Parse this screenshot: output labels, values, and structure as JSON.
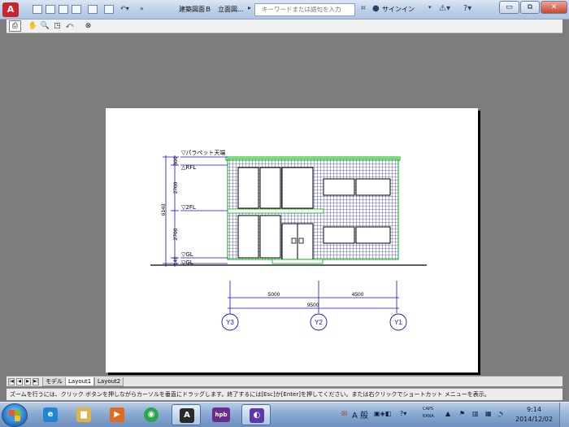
{
  "title_bar": {
    "document_title": "建築図面Ｂ　立面図...",
    "search_placeholder": "キーワードまたは語句を入力",
    "signin_label": "サインイン",
    "buttons": {
      "minimize": "▭",
      "restore": "⧉",
      "close": "✕"
    }
  },
  "toolbar": {
    "tools": [
      {
        "name": "plot-icon",
        "glyph": "⎙"
      },
      {
        "name": "pan-hand-icon",
        "glyph": "✋"
      },
      {
        "name": "zoom-realtime-icon",
        "glyph": "🔍"
      },
      {
        "name": "zoom-window-icon",
        "glyph": "◳"
      },
      {
        "name": "zoom-previous-icon",
        "glyph": "⤺"
      },
      {
        "name": "close-preview-icon",
        "glyph": "⊗"
      }
    ]
  },
  "drawing": {
    "levels": [
      "▽パラペット天端",
      "△RFL",
      "▽2FL",
      "▽GL",
      "▽GL"
    ],
    "vertical_dims": [
      "300",
      "2700",
      "2700",
      "140"
    ],
    "total_height": "6140",
    "horizontal_dims": [
      "5000",
      "4500"
    ],
    "total_width": "9500",
    "grid_axes": [
      "Y3",
      "Y2",
      "Y1"
    ],
    "colors": {
      "line": "#1010cc",
      "green": "#00b000",
      "tile": "#4040b0",
      "black": "#000000"
    }
  },
  "layout_tabs": {
    "nav": [
      "|◀",
      "◀",
      "▶",
      "▶|"
    ],
    "tabs": [
      "モデル",
      "Layout1",
      "Layout2"
    ]
  },
  "status_bar": {
    "message": "ズームを行うには、クリック ボタンを押しながらカーソルを垂直にドラッグします。終了するには[Esc]か[Enter]を押してください。または右クリックでショートカット メニューを表示。"
  },
  "taskbar": {
    "apps": [
      {
        "name": "ie-icon",
        "glyph": "e",
        "color": "#1f86d6"
      },
      {
        "name": "explorer-icon",
        "glyph": "▆",
        "color": "#e0b24a"
      },
      {
        "name": "media-player-icon",
        "glyph": "▶",
        "color": "#e26b1e"
      },
      {
        "name": "chrome-icon",
        "glyph": "◉",
        "color": "#2da44e"
      },
      {
        "name": "autocad-icon",
        "glyph": "A",
        "color": "#2a2a2a"
      },
      {
        "name": "hpb-icon",
        "glyph": "hpb",
        "color": "#6b2c8e"
      },
      {
        "name": "game-icon",
        "glyph": "◐",
        "color": "#5b3aa8"
      }
    ],
    "ime": "A 般",
    "caps": "CAPS",
    "kana": "KANA",
    "clock_time": "9:14",
    "clock_date": "2014/12/02"
  }
}
